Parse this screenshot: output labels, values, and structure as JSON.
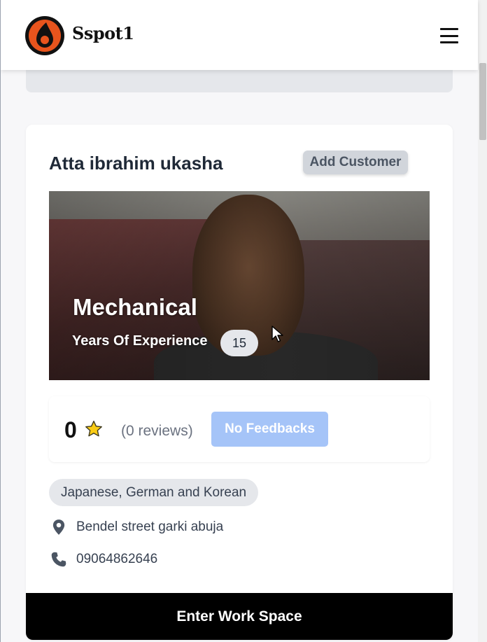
{
  "header": {
    "brand": "Sspot1",
    "logo_icon": "sspot-logo-icon",
    "menu_icon": "hamburger-menu-icon"
  },
  "card": {
    "name": "Atta ibrahim ukasha",
    "add_customer_label": "Add Customer",
    "photo": {
      "trade": "Mechanical",
      "experience_label": "Years Of Experience",
      "experience_years": "15"
    },
    "rating": {
      "score": "0",
      "star_icon": "star-icon",
      "reviews_text": "(0 reviews)",
      "feedback_label": "No Feedbacks"
    },
    "languages": "Japanese, German and Korean",
    "address": "Bendel street garki abuja",
    "phone": "09064862646",
    "workspace_label": "Enter Work Space"
  },
  "colors": {
    "brand_orange": "#e8541d",
    "feedback_button": "#a5c4f8",
    "workspace_button": "#000000"
  }
}
